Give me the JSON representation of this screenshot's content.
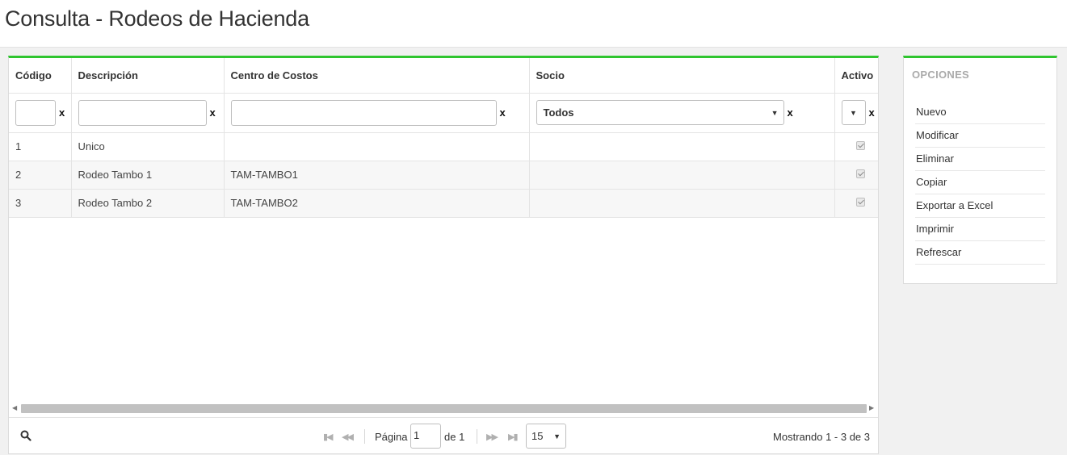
{
  "page": {
    "title": "Consulta - Rodeos de Hacienda"
  },
  "grid": {
    "columns": [
      "Código",
      "Descripción",
      "Centro de Costos",
      "Socio",
      "Activo"
    ],
    "filters": {
      "codigo": "",
      "descripcion": "",
      "centro_costos": "",
      "socio_selected": "Todos",
      "activo_selected": "",
      "clear_label": "x"
    },
    "rows": [
      {
        "codigo": "1",
        "descripcion": "Unico",
        "centro_costos": "",
        "socio": "",
        "activo": true
      },
      {
        "codigo": "2",
        "descripcion": "Rodeo Tambo 1",
        "centro_costos": "TAM-TAMBO1",
        "socio": "",
        "activo": true
      },
      {
        "codigo": "3",
        "descripcion": "Rodeo Tambo 2",
        "centro_costos": "TAM-TAMBO2",
        "socio": "",
        "activo": true
      }
    ]
  },
  "pager": {
    "page_label": "Página",
    "page_value": "1",
    "of_label": "de 1",
    "page_size": "15",
    "status": "Mostrando 1 - 3 de 3"
  },
  "options": {
    "title": "OPCIONES",
    "items": [
      "Nuevo",
      "Modificar",
      "Eliminar",
      "Copiar",
      "Exportar a Excel",
      "Imprimir",
      "Refrescar"
    ]
  },
  "colors": {
    "accent": "#2fc52f",
    "background": "#f1f1f1"
  },
  "icons": {
    "search": "search-icon",
    "first": "first-page-icon",
    "prev": "prev-page-icon",
    "next": "next-page-icon",
    "last": "last-page-icon",
    "caret": "caret-down-icon"
  }
}
